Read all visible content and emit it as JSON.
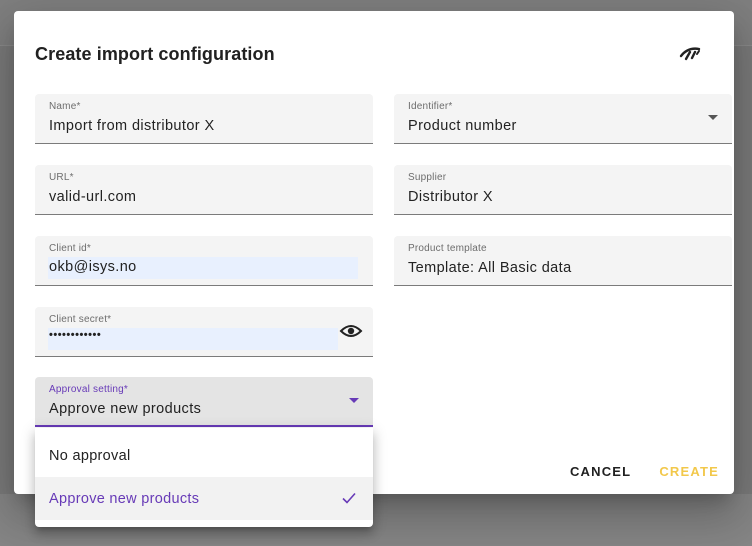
{
  "dialog": {
    "title": "Create import configuration",
    "header_icon": "sync-signal-icon"
  },
  "fields": {
    "name": {
      "label": "Name*",
      "value": "Import from distributor X"
    },
    "identifier": {
      "label": "Identifier*",
      "value": "Product number"
    },
    "url": {
      "label": "URL*",
      "value": "valid-url.com"
    },
    "supplier": {
      "label": "Supplier",
      "value": "Distributor X"
    },
    "client_id": {
      "label": "Client id*",
      "value": "okb@isys.no"
    },
    "product_template": {
      "label": "Product template",
      "value": "Template: All Basic data"
    },
    "client_secret": {
      "label": "Client secret*",
      "value": "••••••••••••",
      "toggle_icon": "eye-icon"
    },
    "approval_setting": {
      "label": "Approval setting*",
      "value": "Approve new products"
    }
  },
  "dropdown": {
    "options": [
      {
        "label": "No approval",
        "selected": false
      },
      {
        "label": "Approve new products",
        "selected": true
      }
    ]
  },
  "actions": {
    "cancel_label": "CANCEL",
    "create_label": "CREATE"
  },
  "colors": {
    "accent": "#673ab7",
    "create_disabled": "#f2c84b",
    "autofill_bg": "#e8f0fe"
  }
}
